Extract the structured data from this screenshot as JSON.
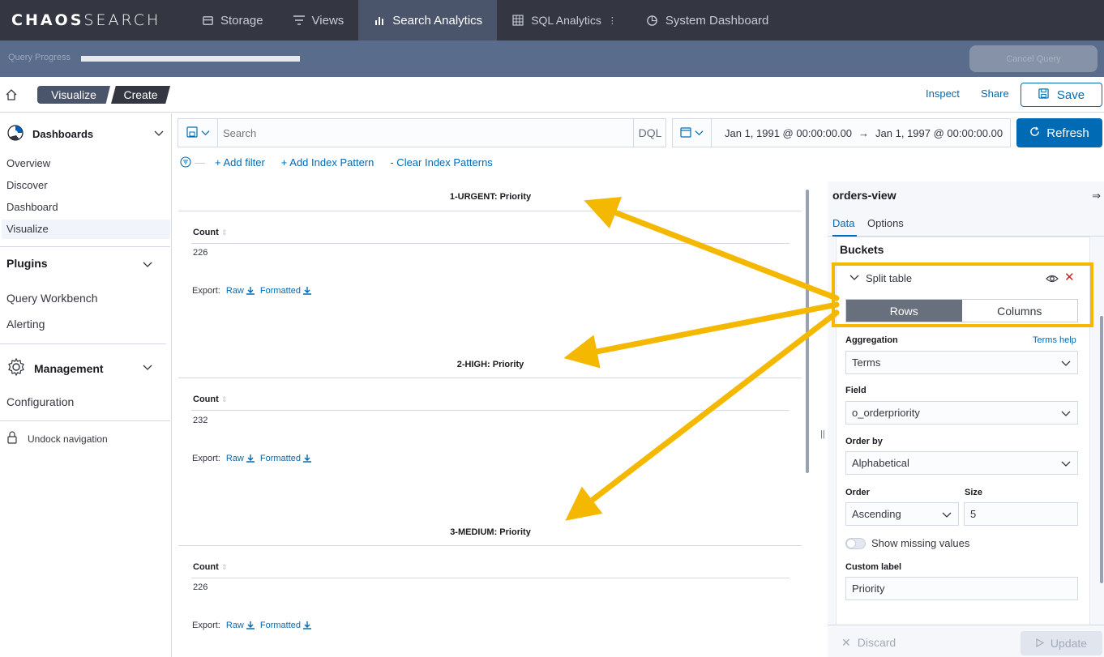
{
  "brand": {
    "part1": "CHAOS",
    "part2": "SEARCH"
  },
  "nav": [
    {
      "label": "Storage",
      "icon": "storage-icon"
    },
    {
      "label": "Views",
      "icon": "views-icon"
    },
    {
      "label": "Search Analytics",
      "icon": "bar-chart-icon"
    },
    {
      "label": "SQL Analytics",
      "icon": "table-grid-icon"
    },
    {
      "label": "System Dashboard",
      "icon": "dashboard-icon"
    }
  ],
  "progress": {
    "label": "Query Progress",
    "fraction": 1.0,
    "cancel_label": "Cancel Query"
  },
  "breadcrumbs": [
    "Visualize",
    "Create"
  ],
  "actions": {
    "inspect": "Inspect",
    "share": "Share",
    "save": "Save"
  },
  "sidebar": {
    "dashboards": {
      "title": "Dashboards",
      "items": [
        "Overview",
        "Discover",
        "Dashboard",
        "Visualize"
      ]
    },
    "plugins": {
      "title": "Plugins",
      "items": [
        "Query Workbench",
        "Alerting"
      ]
    },
    "management": {
      "title": "Management",
      "items": [
        "Configuration"
      ]
    },
    "undock": "Undock navigation"
  },
  "query": {
    "placeholder": "Search",
    "language": "DQL"
  },
  "date": {
    "start": "Jan 1, 1991 @ 00:00:00.00",
    "arrow": "→",
    "end": "Jan 1, 1997 @ 00:00:00.00"
  },
  "refresh": "Refresh",
  "filters": {
    "add_filter": "+ Add filter",
    "add_index": "+ Add Index Pattern",
    "clear_index": "- Clear Index Patterns"
  },
  "tables": [
    {
      "title": "1-URGENT: Priority",
      "column": "Count",
      "value": "226"
    },
    {
      "title": "2-HIGH: Priority",
      "column": "Count",
      "value": "232"
    },
    {
      "title": "3-MEDIUM: Priority",
      "column": "Count",
      "value": "226"
    }
  ],
  "export": {
    "label": "Export:",
    "raw": "Raw",
    "formatted": "Formatted"
  },
  "editor": {
    "title": "orders-view",
    "tabs": [
      "Data",
      "Options"
    ],
    "buckets": "Buckets",
    "split_table": "Split table",
    "rows": "Rows",
    "columns": "Columns",
    "aggregation_label": "Aggregation",
    "terms_help": "Terms help",
    "aggregation_value": "Terms",
    "field_label": "Field",
    "field_value": "o_orderpriority",
    "order_by_label": "Order by",
    "order_by_value": "Alphabetical",
    "order_label": "Order",
    "order_value": "Ascending",
    "size_label": "Size",
    "size_value": "5",
    "show_missing": "Show missing values",
    "custom_label_label": "Custom label",
    "custom_label_value": "Priority",
    "discard": "Discard",
    "update": "Update"
  },
  "colors": {
    "accent": "#006bb4",
    "highlight": "#f5b800",
    "nav_bg": "#343741"
  }
}
